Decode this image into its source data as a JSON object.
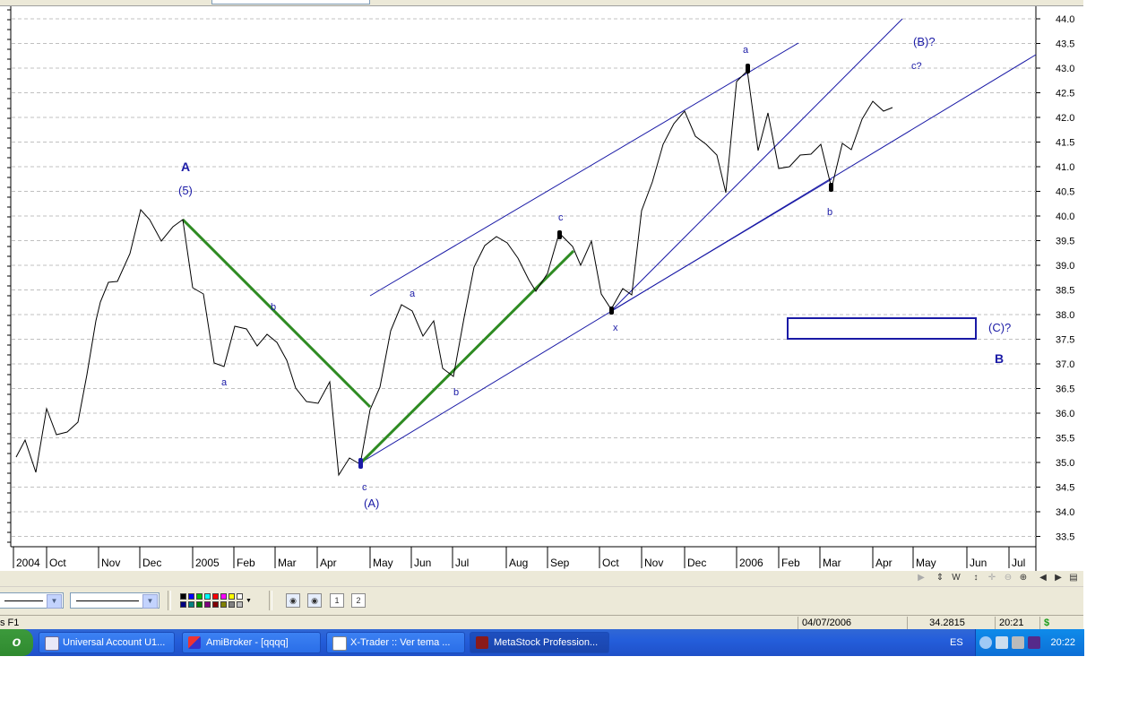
{
  "chart": {
    "price_axis": [
      "44.0",
      "43.5",
      "43.0",
      "42.5",
      "42.0",
      "41.5",
      "41.0",
      "40.5",
      "40.0",
      "39.5",
      "39.0",
      "38.5",
      "38.0",
      "37.5",
      "37.0",
      "36.5",
      "36.0",
      "35.5",
      "35.0",
      "34.5",
      "34.0",
      "33.5"
    ],
    "time_axis": [
      "2004",
      "Oct",
      "Nov",
      "Dec",
      "2005",
      "Feb",
      "Mar",
      "Apr",
      "May",
      "Jun",
      "Jul",
      "Aug",
      "Sep",
      "Oct",
      "Nov",
      "Dec",
      "2006",
      "Feb",
      "Mar",
      "Apr",
      "May",
      "Jun",
      "Jul"
    ],
    "wave_labels": {
      "A": "A",
      "five": "(5)",
      "b1": "b",
      "a1": "a",
      "c1": "c",
      "A_paren": "(A)",
      "a2": "a",
      "b2": "b",
      "c2": "c",
      "x": "x",
      "a3": "a",
      "b3": "b",
      "B_q": "(B)?",
      "c_q": "c?",
      "C_q": "(C)?",
      "B": "B"
    },
    "colors": {
      "price_line": "#000000",
      "channel": "#1a1aa6",
      "trend": "#2e8b22",
      "grid": "#c0c0c0",
      "labels": "#1a1aa6"
    }
  },
  "chart_data": {
    "type": "line",
    "title": "",
    "xlabel": "",
    "ylabel": "",
    "ylim": [
      33.3,
      44.2
    ],
    "x": [
      "2004-09",
      "2004-10",
      "2004-11",
      "2004-12",
      "2005-01",
      "2005-02",
      "2005-03",
      "2005-04",
      "2005-05",
      "2005-06",
      "2005-07",
      "2005-08",
      "2005-09",
      "2005-10",
      "2005-11",
      "2005-12",
      "2006-01",
      "2006-02",
      "2006-03",
      "2006-04"
    ],
    "series": [
      {
        "values": [
          35.6,
          37.8,
          40.1,
          39.5,
          38.5,
          37.6,
          36.4,
          35.0,
          38.1,
          37.8,
          39.2,
          39.3,
          39.6,
          38.1,
          41.3,
          41.5,
          43.0,
          41.0,
          40.6,
          42.2
        ]
      }
    ],
    "grid": true
  },
  "scroll_strip": {
    "icons": [
      "scroll-left-disabled-icon",
      "vertical-scale-icon",
      "weekly-icon",
      "pan-icon",
      "move-icon",
      "zoom-out-icon",
      "zoom-in-icon",
      "scroll-left-icon",
      "scroll-right-icon",
      "resize-icon"
    ]
  },
  "status": {
    "hint": "s F1",
    "date": "04/07/2006",
    "value": "34.2815",
    "time": "20:21",
    "currency": "$"
  },
  "taskbar": {
    "start": "o",
    "tasks": [
      {
        "label": "Universal Account U1...",
        "icon": "account-app-icon"
      },
      {
        "label": "AmiBroker - [qqqq]",
        "icon": "amibroker-icon"
      },
      {
        "label": "X-Trader :: Ver tema ...",
        "icon": "browser-icon"
      },
      {
        "label": "MetaStock Profession...",
        "icon": "metastock-icon"
      }
    ],
    "language": "ES",
    "clock": "20:22"
  }
}
